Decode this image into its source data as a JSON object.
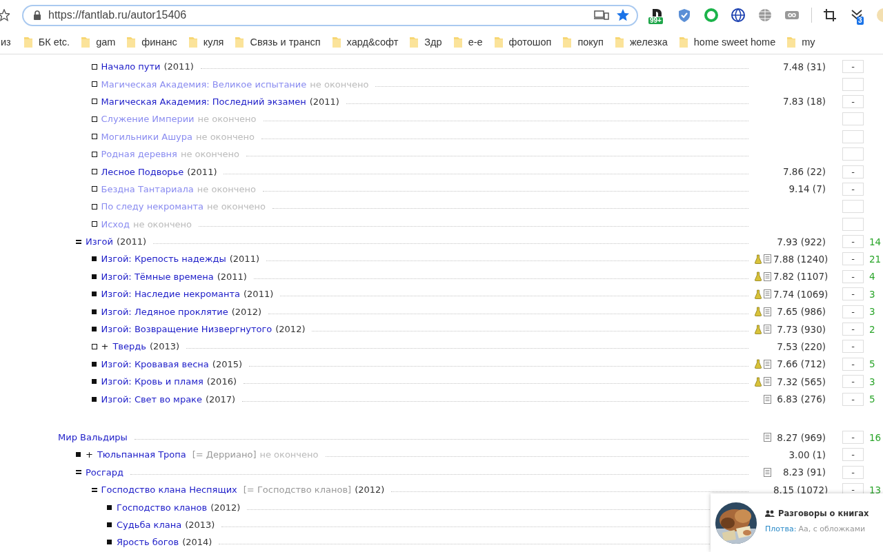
{
  "browser": {
    "url": "https://fantlab.ru/autor15406",
    "extensions": [
      {
        "kind": "d-logo",
        "badge": "99+"
      },
      {
        "kind": "shield"
      },
      {
        "kind": "ring"
      },
      {
        "kind": "globe"
      },
      {
        "kind": "web"
      },
      {
        "kind": "infinity"
      },
      {
        "kind": "crop"
      },
      {
        "kind": "chevrons",
        "badge": "3"
      }
    ],
    "bookmarks": [
      {
        "label": "из",
        "folder": false
      },
      {
        "label": "БК etc.",
        "folder": true
      },
      {
        "label": "gam",
        "folder": true
      },
      {
        "label": "финанс",
        "folder": true
      },
      {
        "label": "куля",
        "folder": true
      },
      {
        "label": "Связь и трансп",
        "folder": true
      },
      {
        "label": "хард&софт",
        "folder": true
      },
      {
        "label": "Здр",
        "folder": true
      },
      {
        "label": "е-е",
        "folder": true
      },
      {
        "label": "фотошоп",
        "folder": true
      },
      {
        "label": "покуп",
        "folder": true
      },
      {
        "label": "железка",
        "folder": true
      },
      {
        "label": "home sweet home",
        "folder": true
      },
      {
        "label": "my",
        "folder": true
      }
    ]
  },
  "sections": [
    {
      "items": [
        {
          "children": [
            {
              "children": [
                {
                  "kind": "outline",
                  "title": "Начало пути",
                  "dimmed": false,
                  "year": "(2011)",
                  "flask": false,
                  "note": false,
                  "rating": "7.48 (31)",
                  "vote_box": true,
                  "vote": "-"
                },
                {
                  "kind": "outline",
                  "title": "Магическая Академия: Великое испытание",
                  "dimmed": true,
                  "status": "не окончено",
                  "flask": false,
                  "note": false,
                  "vote_box": true
                },
                {
                  "kind": "outline",
                  "title": "Магическая Академия: Последний экзамен",
                  "dimmed": false,
                  "year": "(2011)",
                  "flask": false,
                  "note": false,
                  "rating": "7.83 (18)",
                  "vote_box": true,
                  "vote": "-"
                },
                {
                  "kind": "outline",
                  "title": "Служение Империи",
                  "dimmed": true,
                  "status": "не окончено",
                  "flask": false,
                  "note": false,
                  "vote_box": true
                },
                {
                  "kind": "outline",
                  "title": "Могильники Ашура",
                  "dimmed": true,
                  "status": "не окончено",
                  "flask": false,
                  "note": false,
                  "vote_box": true
                },
                {
                  "kind": "outline",
                  "title": "Родная деревня",
                  "dimmed": true,
                  "status": "не окончено",
                  "flask": false,
                  "note": false,
                  "vote_box": true
                },
                {
                  "kind": "outline",
                  "title": "Лесное Подворье",
                  "dimmed": false,
                  "year": "(2011)",
                  "flask": false,
                  "note": false,
                  "rating": "7.86 (22)",
                  "vote_box": true,
                  "vote": "-"
                },
                {
                  "kind": "outline",
                  "title": "Бездна Тантариала",
                  "dimmed": true,
                  "status": "не окончено",
                  "flask": false,
                  "note": false,
                  "rating": "9.14 (7)",
                  "vote_box": true,
                  "vote": "-"
                },
                {
                  "kind": "outline",
                  "title": "По следу некроманта",
                  "dimmed": true,
                  "status": "не окончено",
                  "flask": false,
                  "note": false,
                  "vote_box": true
                },
                {
                  "kind": "outline",
                  "title": "Исход",
                  "dimmed": true,
                  "status": "не окончено",
                  "flask": false,
                  "note": false,
                  "vote_box": true
                }
              ]
            },
            {
              "kind": "collapse",
              "title": "Изгой",
              "dimmed": false,
              "year": "(2011)",
              "flask": false,
              "note": false,
              "rating": "7.93 (922)",
              "vote_box": true,
              "vote": "-",
              "responses": "14",
              "children": [
                {
                  "kind": "filled",
                  "title": "Изгой: Крепость надежды",
                  "dimmed": false,
                  "year": "(2011)",
                  "flask": true,
                  "note": true,
                  "rating": "7.88 (1240)",
                  "vote_box": true,
                  "vote": "-",
                  "responses": "21"
                },
                {
                  "kind": "filled",
                  "title": "Изгой: Тёмные времена",
                  "dimmed": false,
                  "year": "(2011)",
                  "flask": true,
                  "note": true,
                  "rating": "7.82 (1107)",
                  "vote_box": true,
                  "vote": "-",
                  "responses": "4"
                },
                {
                  "kind": "filled",
                  "title": "Изгой: Наследие некроманта",
                  "dimmed": false,
                  "year": "(2011)",
                  "flask": true,
                  "note": true,
                  "rating": "7.74 (1069)",
                  "vote_box": true,
                  "vote": "-",
                  "responses": "3"
                },
                {
                  "kind": "filled",
                  "title": "Изгой: Ледяное проклятие",
                  "dimmed": false,
                  "year": "(2012)",
                  "flask": true,
                  "note": true,
                  "rating": "7.65 (986)",
                  "vote_box": true,
                  "vote": "-",
                  "responses": "3"
                },
                {
                  "kind": "filled",
                  "title": "Изгой: Возвращение Низвергнутого",
                  "dimmed": false,
                  "year": "(2012)",
                  "flask": true,
                  "note": true,
                  "rating": "7.73 (930)",
                  "vote_box": true,
                  "vote": "-",
                  "responses": "2"
                },
                {
                  "kind": "outline",
                  "prefix": "+",
                  "title": "Твердь",
                  "dimmed": false,
                  "year": "(2013)",
                  "flask": false,
                  "note": false,
                  "rating": "7.53 (220)",
                  "vote_box": true,
                  "vote": "-"
                },
                {
                  "kind": "filled",
                  "title": "Изгой: Кровавая весна",
                  "dimmed": false,
                  "year": "(2015)",
                  "flask": true,
                  "note": true,
                  "rating": "7.66 (712)",
                  "vote_box": true,
                  "vote": "-",
                  "responses": "5"
                },
                {
                  "kind": "filled",
                  "title": "Изгой: Кровь и пламя",
                  "dimmed": false,
                  "year": "(2016)",
                  "flask": true,
                  "note": true,
                  "rating": "7.32 (565)",
                  "vote_box": true,
                  "vote": "-",
                  "responses": "3"
                },
                {
                  "kind": "filled",
                  "title": "Изгой: Свет во мраке",
                  "dimmed": false,
                  "year": "(2017)",
                  "flask": false,
                  "note": true,
                  "rating": "6.83 (276)",
                  "vote_box": true,
                  "vote": "-",
                  "responses": "5"
                }
              ]
            }
          ]
        }
      ]
    },
    {
      "items": [
        {
          "title": "Мир Вальдиры",
          "dimmed": false,
          "flask": false,
          "note": true,
          "rating": "8.27 (969)",
          "vote_box": true,
          "vote": "-",
          "responses": "16",
          "children": [
            {
              "kind": "filled",
              "prefix": "+",
              "title": "Тюльпанная Тропа",
              "dimmed": false,
              "alt_title": "[= Дерриано]",
              "status": "не окончено",
              "flask": false,
              "note": false,
              "rating": "3.00 (1)",
              "vote_box": true,
              "vote": "-"
            },
            {
              "kind": "collapse",
              "title": "Росгард",
              "dimmed": false,
              "flask": false,
              "note": true,
              "rating": "8.23 (91)",
              "vote_box": true,
              "vote": "-",
              "children": [
                {
                  "kind": "collapse",
                  "title": "Господство клана Неспящих",
                  "dimmed": false,
                  "alt_title": "[= Господство кланов]",
                  "year": "(2012)",
                  "flask": false,
                  "note": false,
                  "rating": "8.15 (1072)",
                  "vote_box": true,
                  "vote": "-",
                  "responses": "13",
                  "children": [
                    {
                      "kind": "filled",
                      "title": "Господство кланов",
                      "dimmed": false,
                      "year": "(2012)",
                      "flask": false,
                      "note": false,
                      "vote_box": false
                    },
                    {
                      "kind": "filled",
                      "title": "Судьба клана",
                      "dimmed": false,
                      "year": "(2013)",
                      "flask": false,
                      "note": false,
                      "vote_box": false
                    },
                    {
                      "kind": "filled",
                      "title": "Ярость богов",
                      "dimmed": false,
                      "year": "(2014)",
                      "flask": false,
                      "note": false,
                      "vote_box": false
                    }
                  ]
                }
              ]
            }
          ]
        }
      ]
    }
  ],
  "chat_popup": {
    "title": "Разговоры о книгах",
    "author": "Плотва:",
    "message": "Аа, с обложками"
  }
}
